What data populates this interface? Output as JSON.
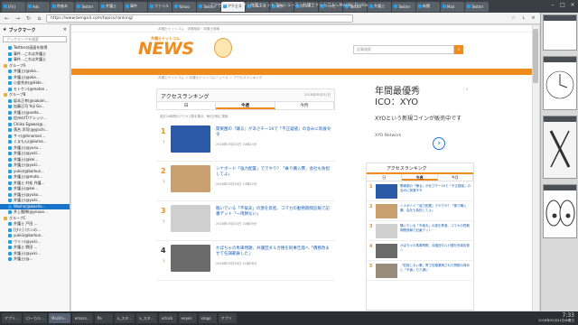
{
  "window": {
    "title": "アクセスランキング | 弁護士ドットコムニュース | 弁護士ドットコム - Mozilla Firefox"
  },
  "tabs": [
    {
      "label": "[Fri]"
    },
    {
      "label": "Ads"
    },
    {
      "label": "他者本"
    },
    {
      "label": "Twitter"
    },
    {
      "label": "弁護士"
    },
    {
      "label": "事件"
    },
    {
      "label": "ファイル"
    },
    {
      "label": "Yahoo"
    },
    {
      "label": "Twitter"
    },
    {
      "label": "アクセス"
    },
    {
      "label": "ニュース"
    },
    {
      "label": "東京"
    },
    {
      "label": "ポルト"
    },
    {
      "label": "ハッピー"
    },
    {
      "label": "Twitter"
    },
    {
      "label": "弁護士"
    },
    {
      "label": "Twitter"
    },
    {
      "label": "新聞"
    },
    {
      "label": "Mail"
    },
    {
      "label": "Twitter"
    }
  ],
  "nav": {
    "url": "https://www.bengo4.com/topics/ranking/"
  },
  "sidebar": {
    "title": "ブックマーク",
    "search_placeholder": "ブックマークを検索",
    "items": [
      {
        "label": "Twitterの画面を取得",
        "folder": false
      },
      {
        "label": "事件…これは弁護士",
        "folder": false
      },
      {
        "label": "事件…これは弁護士",
        "folder": false
      },
      {
        "label": "グループA",
        "folder": true
      },
      {
        "label": "弁護士(@oka…",
        "folder": false
      },
      {
        "label": "弁護士(@oka…",
        "folder": false
      },
      {
        "label": "小倉秀夫(@Hide…",
        "folder": false
      },
      {
        "label": "モトケン(@moton…",
        "folder": false
      },
      {
        "label": "グループB",
        "folder": true
      },
      {
        "label": "坂本正幸(@sakam…",
        "folder": false
      },
      {
        "label": "加藤正司 Yoji Go…",
        "folder": false
      },
      {
        "label": "弁護士(@ueda…",
        "folder": false
      },
      {
        "label": "信州のIT/ナレッジ…",
        "folder": false
      },
      {
        "label": "Chiiko Egawa(@…",
        "folder": false
      },
      {
        "label": "落合 洋司(@yjochi…",
        "folder": false
      },
      {
        "label": "サイ(@hinomori…",
        "folder": false
      },
      {
        "label": "くまもん(@kuma…",
        "folder": false
      },
      {
        "label": "弁護士(@yusu…",
        "folder": false
      },
      {
        "label": "弁護士(@yuki…",
        "folder": false
      },
      {
        "label": "弁護士(@kei…",
        "folder": false
      },
      {
        "label": "弁護士(@yuki…",
        "folder": false
      },
      {
        "label": "yukio(@barkuz…",
        "folder": false
      },
      {
        "label": "弁護士(@muto…",
        "folder": false
      },
      {
        "label": "弁護士 村松 弁護…",
        "folder": false
      },
      {
        "label": "弁護士(@kei…",
        "folder": false
      },
      {
        "label": "弁護士(@yuko…",
        "folder": false
      },
      {
        "label": "弁護士(@yuki…",
        "folder": false
      },
      {
        "label": "Washo(@washo…",
        "folder": false,
        "selected": true
      },
      {
        "label": "井上雅博(@ynoue…",
        "folder": false
      },
      {
        "label": "グループC",
        "folder": true
      },
      {
        "label": "弁護士 戸田 …",
        "folder": false
      },
      {
        "label": "[ぴぐ] (ホンの…",
        "folder": false
      },
      {
        "label": "yukio(@barkuz…",
        "folder": false
      },
      {
        "label": "ウリン(@yuki…",
        "folder": false
      },
      {
        "label": "弁護士 野田 …",
        "folder": false
      },
      {
        "label": "弁護士(@yuki…",
        "folder": false
      },
      {
        "label": "弁護士(@…",
        "folder": false
      }
    ]
  },
  "site": {
    "logo_small": "弁護士ドットコム",
    "logo_big": "NEWS",
    "search_placeholder": "記事検索",
    "breadcrumb": "弁護士ドットコム ＞ 弁護士ドットコムニュース ＞ アクセスランキング",
    "topbar_text": "弁護士ドットコム　法律相談・弁護士検索"
  },
  "ranking": {
    "title": "アクセスランキング",
    "date": "2018年05月31日",
    "tabs": [
      "日",
      "今週",
      "今月"
    ],
    "note": "過去24時間のアクセス数を集計。毎日日時に更新。",
    "items": [
      {
        "num": "1",
        "title": "関東圏の「踊る」があさチー16で「不正疑惑」の含みに新展令令",
        "date": "2018年05月30日 10時24分",
        "color": "#2a5aa8"
      },
      {
        "num": "2",
        "title": "シナボード「強力配置」ででやり？「乗り購入賽、会社も負担してよ」",
        "date": "2018年05月30日 10時52分",
        "color": "#caa070"
      },
      {
        "num": "3",
        "title": "騒いでいる「不倫夫」の激を昇進、コマカの勤務期間追報で記番デット「一両勝ない」",
        "date": "2018年05月30日 10時09分",
        "color": "#cfcfcf"
      },
      {
        "num": "4",
        "title": "かぼちゃの馬車問題、弁護団ダルガ捜を刑事告発へ「債務改ませて任調範雇した」",
        "date": "2018年05月30日 11時06分",
        "color": "#6b6b6b"
      }
    ]
  },
  "ad": {
    "line1": "年間最優秀",
    "line2": "ICO：XYO",
    "body": "XYOという新規コインが販売中です",
    "sponsor": "XYO Network",
    "info": "i ×"
  },
  "side_rank": {
    "title": "アクセスランキング",
    "tabs": [
      "日",
      "今週",
      "今月"
    ],
    "items": [
      {
        "num": "1",
        "title": "関東圏の「踊る」があさチー16で「不正疑惑」の含みに新展令令",
        "color": "#2a5aa8"
      },
      {
        "num": "2",
        "title": "シナボード「強力配置」でやりや？「乗り購入賽、会社も負担してよ」",
        "color": "#caa070"
      },
      {
        "num": "3",
        "title": "騒いでいる「不倫夫」の激を昇進、コマカの勤務期間追報で記番デット",
        "color": "#cfcfcf"
      },
      {
        "num": "4",
        "title": "かぼちゃの馬車問題、弁護団ダルガ捜を刑事告発へ",
        "color": "#6b6b6b"
      },
      {
        "num": "5",
        "title": "「妊娠しない妻」寄で性格漏洩された問題の責めに「不倫」ちた通い",
        "color": "#9a8c7a"
      }
    ]
  },
  "taskbar": {
    "items": [
      "アプリ…",
      "ローカル…",
      "Mozilla…",
      "emacs…",
      "fle",
      "x_スタ…",
      "x_スタ…",
      "xclock",
      "eeyes",
      "xlogo",
      "アプリ"
    ],
    "time": "7:33",
    "date": "2018年05月31日木曜日"
  }
}
